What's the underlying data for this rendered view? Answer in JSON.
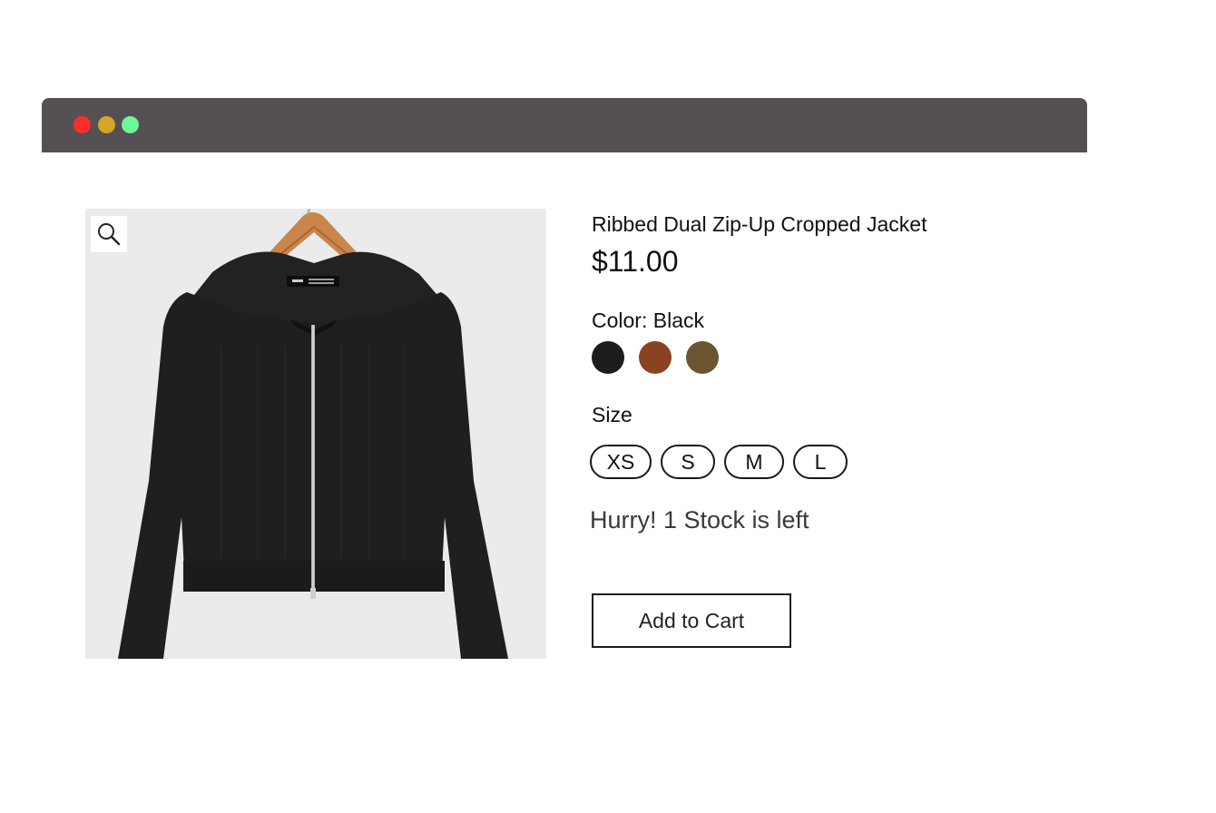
{
  "window": {
    "controls": [
      "close",
      "minimize",
      "maximize"
    ],
    "colors": {
      "close": "#ff2d2d",
      "minimize": "#d4a62a",
      "maximize": "#6ff59a",
      "bar": "#545054"
    }
  },
  "product": {
    "title": "Ribbed Dual Zip-Up Cropped Jacket",
    "price": "$11.00",
    "image_icon": "zoom-icon",
    "color_label": "Color: Black",
    "colors": [
      {
        "name": "Black",
        "hex": "#1c1c1c"
      },
      {
        "name": "Brown",
        "hex": "#8a4220"
      },
      {
        "name": "Olive",
        "hex": "#6b5430"
      }
    ],
    "size_label": "Size",
    "sizes": [
      "XS",
      "S",
      "M",
      "L"
    ],
    "stock_message": "Hurry! 1 Stock is left",
    "add_to_cart_label": "Add to Cart"
  }
}
